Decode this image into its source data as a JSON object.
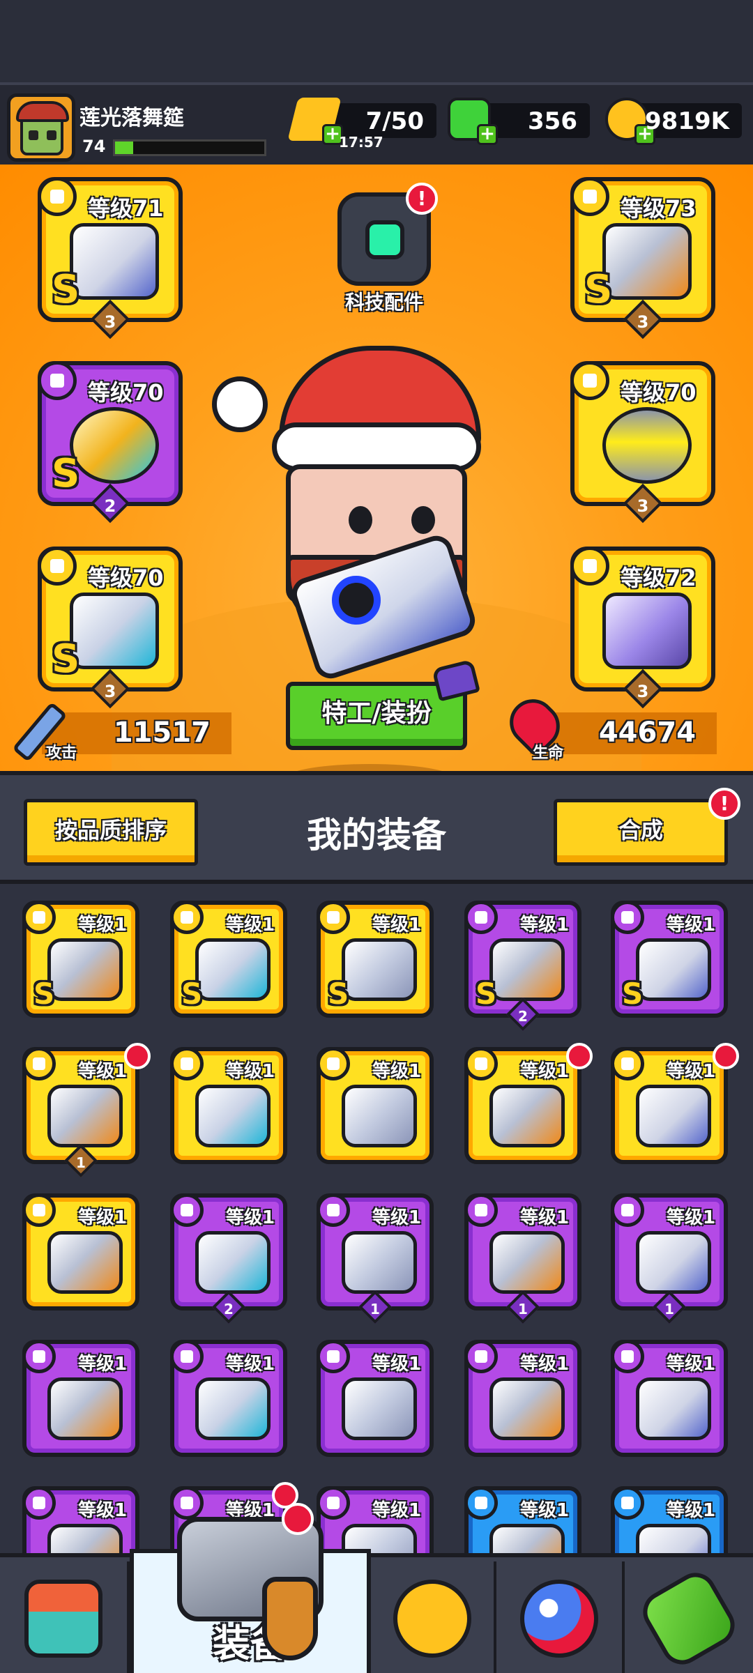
{
  "player": {
    "name": "莲光落舞筵",
    "level": "74",
    "xp_fraction": 0.12
  },
  "resources": {
    "energy": {
      "value": "7/50",
      "timer": "17:57",
      "icon": "lightning-icon"
    },
    "gems": {
      "value": "356",
      "icon": "green-gem-icon"
    },
    "coins": {
      "value": "9819K",
      "icon": "gold-coin-icon"
    }
  },
  "tech": {
    "label": "科技配件",
    "alert": "!"
  },
  "equipped": {
    "weapon": {
      "level": "等级71",
      "grade": "S",
      "stars": "3"
    },
    "armor": {
      "level": "等级73",
      "grade": "S",
      "stars": "3"
    },
    "ring": {
      "level": "等级70",
      "grade": "S",
      "stars": "2"
    },
    "belt": {
      "level": "等级70",
      "stars": "3"
    },
    "gloves": {
      "level": "等级70",
      "grade": "S",
      "stars": "3"
    },
    "boots": {
      "level": "等级72",
      "stars": "3"
    }
  },
  "stats": {
    "attack_label": "攻击",
    "attack_value": "11517",
    "hp_label": "生命",
    "hp_value": "44674"
  },
  "agent_button": "特工/装扮",
  "section": {
    "sort_button": "按品质排序",
    "title": "我的装备",
    "merge_button": "合成",
    "merge_alert": "!"
  },
  "inventory": [
    {
      "level": "等级1",
      "grade": "S",
      "color": "yellow"
    },
    {
      "level": "等级1",
      "grade": "S",
      "color": "yellow"
    },
    {
      "level": "等级1",
      "grade": "S",
      "color": "yellow"
    },
    {
      "level": "等级1",
      "grade": "S",
      "color": "purple",
      "stars": "2"
    },
    {
      "level": "等级1",
      "grade": "S",
      "color": "purple"
    },
    {
      "level": "等级1",
      "color": "yellow",
      "stars": "1",
      "alert": true
    },
    {
      "level": "等级1",
      "color": "yellow"
    },
    {
      "level": "等级1",
      "color": "yellow"
    },
    {
      "level": "等级1",
      "color": "yellow",
      "alert": true
    },
    {
      "level": "等级1",
      "color": "yellow",
      "alert": true
    },
    {
      "level": "等级1",
      "color": "yellow"
    },
    {
      "level": "等级1",
      "color": "purple",
      "stars": "2"
    },
    {
      "level": "等级1",
      "color": "purple",
      "stars": "1"
    },
    {
      "level": "等级1",
      "color": "purple",
      "stars": "1"
    },
    {
      "level": "等级1",
      "color": "purple",
      "stars": "1"
    },
    {
      "level": "等级1",
      "color": "purple"
    },
    {
      "level": "等级1",
      "color": "purple"
    },
    {
      "level": "等级1",
      "color": "purple"
    },
    {
      "level": "等级1",
      "color": "purple"
    },
    {
      "level": "等级1",
      "color": "purple"
    },
    {
      "level": "等级1",
      "color": "purple"
    },
    {
      "level": "等级1",
      "color": "purple",
      "alert": true
    },
    {
      "level": "等级1",
      "color": "purple"
    },
    {
      "level": "等级1",
      "color": "blue"
    },
    {
      "level": "等级1",
      "color": "blue"
    }
  ],
  "nav": {
    "tabs": [
      {
        "name": "shop-tab",
        "icon": "shop-icon"
      },
      {
        "name": "equipment-tab",
        "icon": "revolver-icon",
        "label": "装备",
        "active": true
      },
      {
        "name": "battle-tab",
        "icon": "star-swords-icon"
      },
      {
        "name": "gacha-tab",
        "icon": "ball-icon"
      },
      {
        "name": "gene-tab",
        "icon": "dna-capsule-icon"
      }
    ]
  },
  "colors": {
    "stage": "#ff9f1a",
    "legendary": "#ffe021",
    "epic": "#b44ae6",
    "rare": "#2a9cf5",
    "green_button": "#59cf2a"
  }
}
